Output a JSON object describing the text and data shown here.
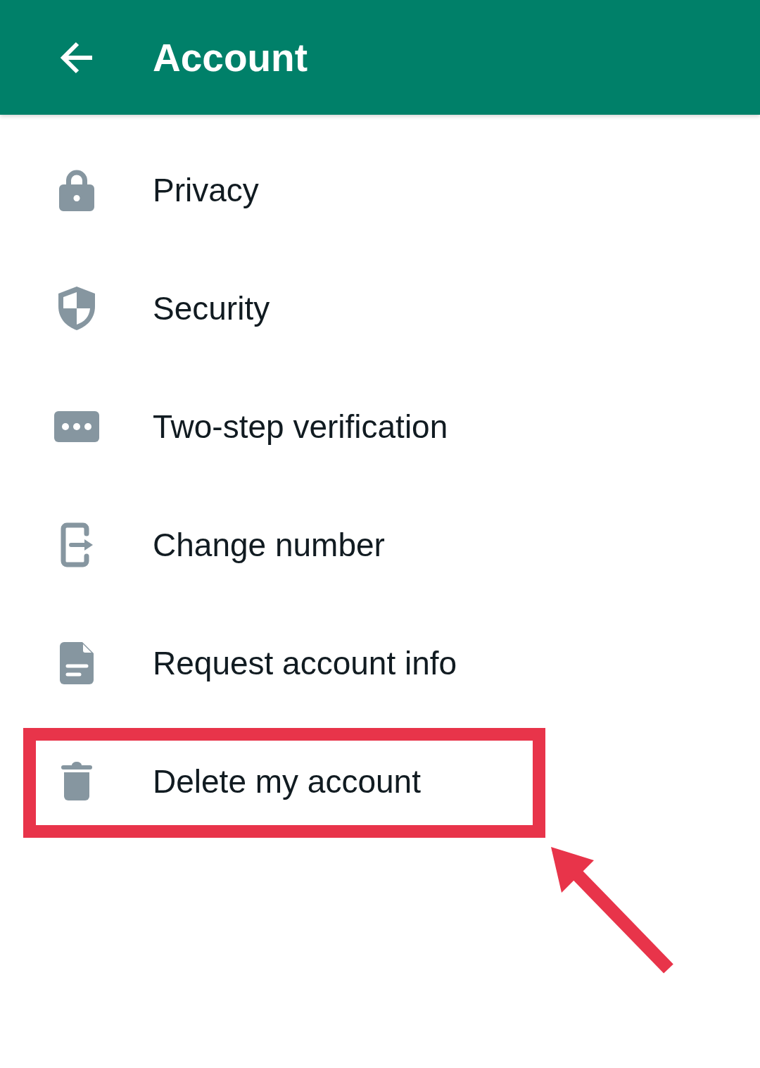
{
  "app_bar": {
    "title": "Account"
  },
  "items": [
    {
      "label": "Privacy",
      "kind": "lock",
      "highlighted": false
    },
    {
      "label": "Security",
      "kind": "shield",
      "highlighted": false
    },
    {
      "label": "Two-step verification",
      "kind": "dots",
      "highlighted": false
    },
    {
      "label": "Change number",
      "kind": "exit",
      "highlighted": false
    },
    {
      "label": "Request account info",
      "kind": "document",
      "highlighted": false
    },
    {
      "label": "Delete my account",
      "kind": "trash",
      "highlighted": true
    }
  ]
}
